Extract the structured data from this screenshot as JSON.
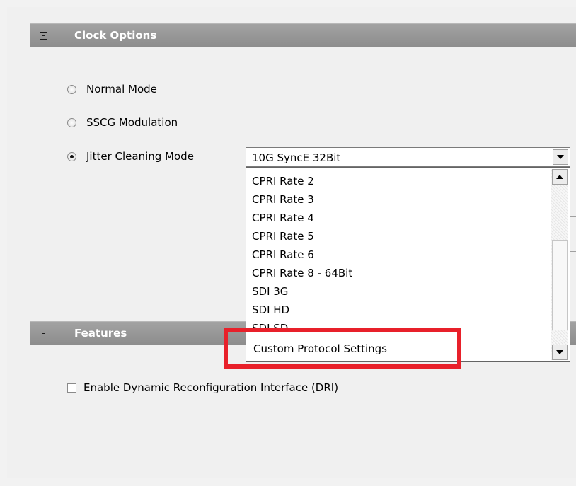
{
  "clock_options": {
    "header": "Clock Options",
    "modes": [
      {
        "label": "Normal Mode",
        "selected": false
      },
      {
        "label": "SSCG Modulation",
        "selected": false
      },
      {
        "label": "Jitter Cleaning Mode",
        "selected": true
      }
    ],
    "combo_value": "10G SyncE 32Bit"
  },
  "dropdown": {
    "items": [
      "CPRI Rate 2",
      "CPRI Rate 3",
      "CPRI Rate 4",
      "CPRI Rate 5",
      "CPRI Rate 6",
      "CPRI Rate 8 - 64Bit",
      "SDI 3G",
      "SDI HD",
      "SDI SD"
    ],
    "highlighted_item": "Custom Protocol Settings"
  },
  "features": {
    "header": "Features",
    "checkbox_label": "Enable Dynamic Reconfiguration Interface (DRI)",
    "checked": false
  },
  "colors": {
    "header_bg": "#969696",
    "highlight_border": "#e8202a"
  }
}
